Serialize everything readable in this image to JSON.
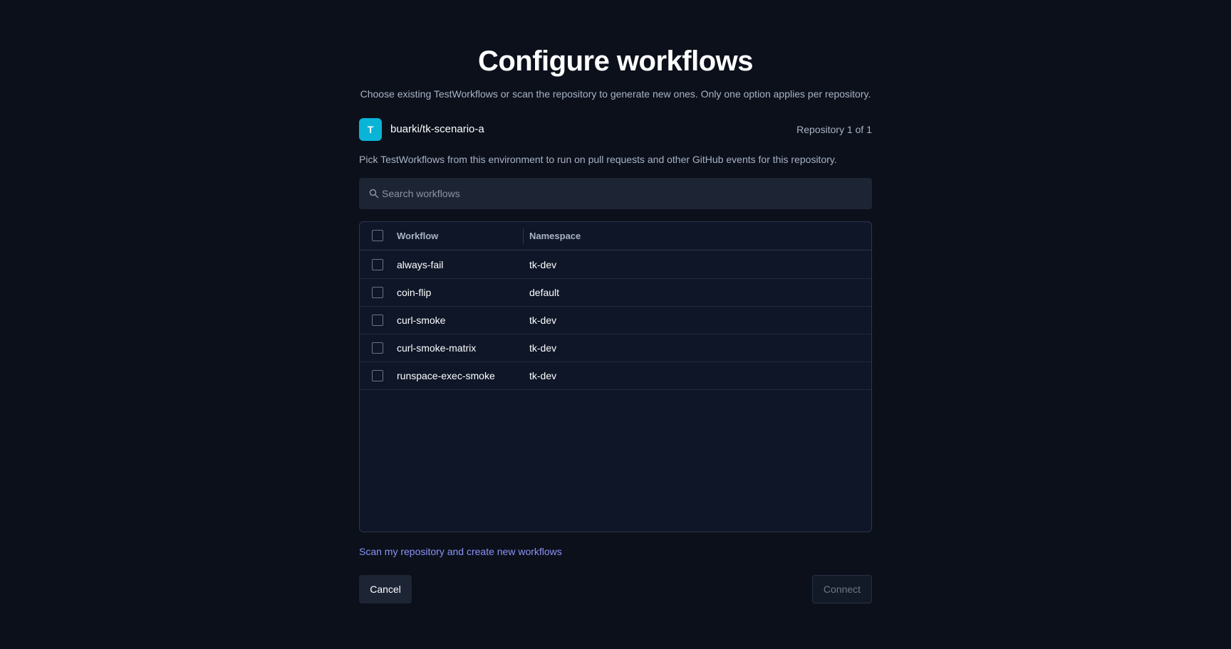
{
  "header": {
    "title": "Configure workflows",
    "subtitle": "Choose existing TestWorkflows or scan the repository to generate new ones. Only one option applies per repository."
  },
  "repository": {
    "avatar_letter": "T",
    "avatar_color": "#0ab4d6",
    "name": "buarki/tk-scenario-a",
    "count_label": "Repository 1 of 1"
  },
  "helper_text": "Pick TestWorkflows from this environment to run on pull requests and other GitHub events for this repository.",
  "search": {
    "icon": "search-icon",
    "placeholder": "Search workflows",
    "value": ""
  },
  "table": {
    "columns": [
      "Workflow",
      "Namespace"
    ],
    "rows": [
      {
        "workflow": "always-fail",
        "namespace": "tk-dev",
        "checked": false
      },
      {
        "workflow": "coin-flip",
        "namespace": "default",
        "checked": false
      },
      {
        "workflow": "curl-smoke",
        "namespace": "tk-dev",
        "checked": false
      },
      {
        "workflow": "curl-smoke-matrix",
        "namespace": "tk-dev",
        "checked": false
      },
      {
        "workflow": "runspace-exec-smoke",
        "namespace": "tk-dev",
        "checked": false
      }
    ]
  },
  "scan_link": "Scan my repository and create new workflows",
  "actions": {
    "cancel_label": "Cancel",
    "connect_label": "Connect"
  },
  "colors": {
    "background": "#0b101b",
    "link": "#8b93f5",
    "accent": "#0ab4d6"
  }
}
